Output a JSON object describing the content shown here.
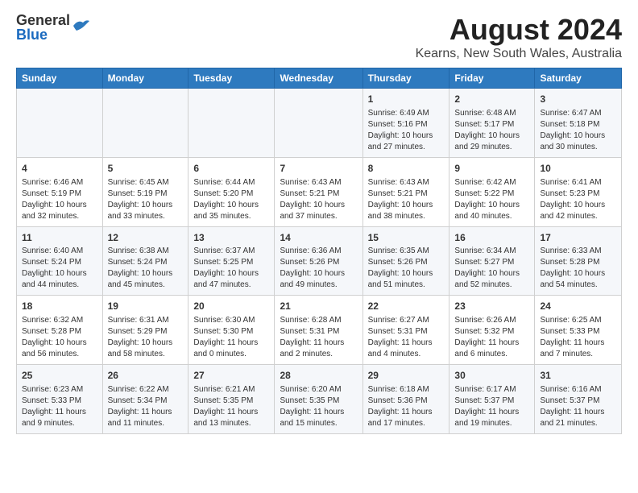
{
  "header": {
    "logo": {
      "general": "General",
      "blue": "Blue"
    },
    "title": "August 2024",
    "subtitle": "Kearns, New South Wales, Australia"
  },
  "calendar": {
    "days": [
      "Sunday",
      "Monday",
      "Tuesday",
      "Wednesday",
      "Thursday",
      "Friday",
      "Saturday"
    ],
    "weeks": [
      [
        {
          "day": "",
          "info": ""
        },
        {
          "day": "",
          "info": ""
        },
        {
          "day": "",
          "info": ""
        },
        {
          "day": "",
          "info": ""
        },
        {
          "day": "1",
          "info": "Sunrise: 6:49 AM\nSunset: 5:16 PM\nDaylight: 10 hours\nand 27 minutes."
        },
        {
          "day": "2",
          "info": "Sunrise: 6:48 AM\nSunset: 5:17 PM\nDaylight: 10 hours\nand 29 minutes."
        },
        {
          "day": "3",
          "info": "Sunrise: 6:47 AM\nSunset: 5:18 PM\nDaylight: 10 hours\nand 30 minutes."
        }
      ],
      [
        {
          "day": "4",
          "info": "Sunrise: 6:46 AM\nSunset: 5:19 PM\nDaylight: 10 hours\nand 32 minutes."
        },
        {
          "day": "5",
          "info": "Sunrise: 6:45 AM\nSunset: 5:19 PM\nDaylight: 10 hours\nand 33 minutes."
        },
        {
          "day": "6",
          "info": "Sunrise: 6:44 AM\nSunset: 5:20 PM\nDaylight: 10 hours\nand 35 minutes."
        },
        {
          "day": "7",
          "info": "Sunrise: 6:43 AM\nSunset: 5:21 PM\nDaylight: 10 hours\nand 37 minutes."
        },
        {
          "day": "8",
          "info": "Sunrise: 6:43 AM\nSunset: 5:21 PM\nDaylight: 10 hours\nand 38 minutes."
        },
        {
          "day": "9",
          "info": "Sunrise: 6:42 AM\nSunset: 5:22 PM\nDaylight: 10 hours\nand 40 minutes."
        },
        {
          "day": "10",
          "info": "Sunrise: 6:41 AM\nSunset: 5:23 PM\nDaylight: 10 hours\nand 42 minutes."
        }
      ],
      [
        {
          "day": "11",
          "info": "Sunrise: 6:40 AM\nSunset: 5:24 PM\nDaylight: 10 hours\nand 44 minutes."
        },
        {
          "day": "12",
          "info": "Sunrise: 6:38 AM\nSunset: 5:24 PM\nDaylight: 10 hours\nand 45 minutes."
        },
        {
          "day": "13",
          "info": "Sunrise: 6:37 AM\nSunset: 5:25 PM\nDaylight: 10 hours\nand 47 minutes."
        },
        {
          "day": "14",
          "info": "Sunrise: 6:36 AM\nSunset: 5:26 PM\nDaylight: 10 hours\nand 49 minutes."
        },
        {
          "day": "15",
          "info": "Sunrise: 6:35 AM\nSunset: 5:26 PM\nDaylight: 10 hours\nand 51 minutes."
        },
        {
          "day": "16",
          "info": "Sunrise: 6:34 AM\nSunset: 5:27 PM\nDaylight: 10 hours\nand 52 minutes."
        },
        {
          "day": "17",
          "info": "Sunrise: 6:33 AM\nSunset: 5:28 PM\nDaylight: 10 hours\nand 54 minutes."
        }
      ],
      [
        {
          "day": "18",
          "info": "Sunrise: 6:32 AM\nSunset: 5:28 PM\nDaylight: 10 hours\nand 56 minutes."
        },
        {
          "day": "19",
          "info": "Sunrise: 6:31 AM\nSunset: 5:29 PM\nDaylight: 10 hours\nand 58 minutes."
        },
        {
          "day": "20",
          "info": "Sunrise: 6:30 AM\nSunset: 5:30 PM\nDaylight: 11 hours\nand 0 minutes."
        },
        {
          "day": "21",
          "info": "Sunrise: 6:28 AM\nSunset: 5:31 PM\nDaylight: 11 hours\nand 2 minutes."
        },
        {
          "day": "22",
          "info": "Sunrise: 6:27 AM\nSunset: 5:31 PM\nDaylight: 11 hours\nand 4 minutes."
        },
        {
          "day": "23",
          "info": "Sunrise: 6:26 AM\nSunset: 5:32 PM\nDaylight: 11 hours\nand 6 minutes."
        },
        {
          "day": "24",
          "info": "Sunrise: 6:25 AM\nSunset: 5:33 PM\nDaylight: 11 hours\nand 7 minutes."
        }
      ],
      [
        {
          "day": "25",
          "info": "Sunrise: 6:23 AM\nSunset: 5:33 PM\nDaylight: 11 hours\nand 9 minutes."
        },
        {
          "day": "26",
          "info": "Sunrise: 6:22 AM\nSunset: 5:34 PM\nDaylight: 11 hours\nand 11 minutes."
        },
        {
          "day": "27",
          "info": "Sunrise: 6:21 AM\nSunset: 5:35 PM\nDaylight: 11 hours\nand 13 minutes."
        },
        {
          "day": "28",
          "info": "Sunrise: 6:20 AM\nSunset: 5:35 PM\nDaylight: 11 hours\nand 15 minutes."
        },
        {
          "day": "29",
          "info": "Sunrise: 6:18 AM\nSunset: 5:36 PM\nDaylight: 11 hours\nand 17 minutes."
        },
        {
          "day": "30",
          "info": "Sunrise: 6:17 AM\nSunset: 5:37 PM\nDaylight: 11 hours\nand 19 minutes."
        },
        {
          "day": "31",
          "info": "Sunrise: 6:16 AM\nSunset: 5:37 PM\nDaylight: 11 hours\nand 21 minutes."
        }
      ]
    ]
  }
}
